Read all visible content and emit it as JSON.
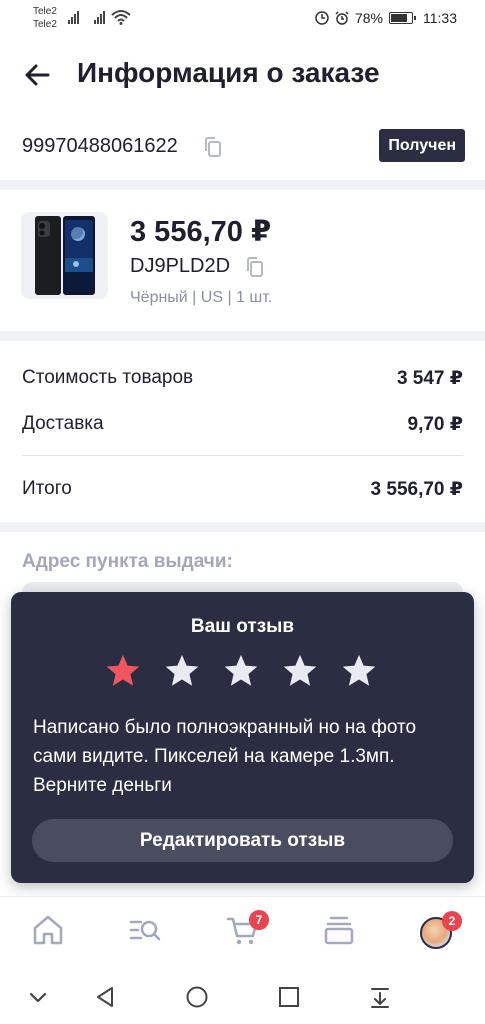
{
  "status_bar": {
    "carrier_1": "Tele2",
    "carrier_2": "Tele2",
    "battery": "78%",
    "battery_level": 0.78,
    "time": "11:33"
  },
  "header": {
    "title": "Информация о заказе",
    "back_icon": "arrow-left-icon"
  },
  "order": {
    "number": "99970488061622",
    "status": "Получен"
  },
  "product": {
    "price": "3 556,70 ₽",
    "sku": "DJ9PLD2D",
    "variant": "Чёрный | US | 1 шт."
  },
  "totals": {
    "goods_label": "Стоимость товаров",
    "goods_value": "3 547 ₽",
    "delivery_label": "Доставка",
    "delivery_value": "9,70 ₽",
    "total_label": "Итого",
    "total_value": "3 556,70 ₽"
  },
  "pickup": {
    "label": "Адрес пункта выдачи:"
  },
  "review": {
    "title": "Ваш отзыв",
    "rating": 1,
    "max_rating": 5,
    "text": "Написано было полноэкранный но на фото сами видите. Пикселей на камере 1.3мп. Верните деньги",
    "edit_label": "Редактировать отзыв",
    "star_active_color": "#f0565e",
    "star_inactive_color": "#e9ebf2"
  },
  "bottom_nav": {
    "items": [
      "home-icon",
      "catalog-search-icon",
      "cart-icon",
      "orders-icon",
      "profile-avatar"
    ],
    "cart_badge": "7",
    "profile_badge": "2"
  },
  "colors": {
    "primary_dark": "#2b2d42",
    "accent_red": "#e8454f",
    "muted_text": "#8a8fa3"
  }
}
